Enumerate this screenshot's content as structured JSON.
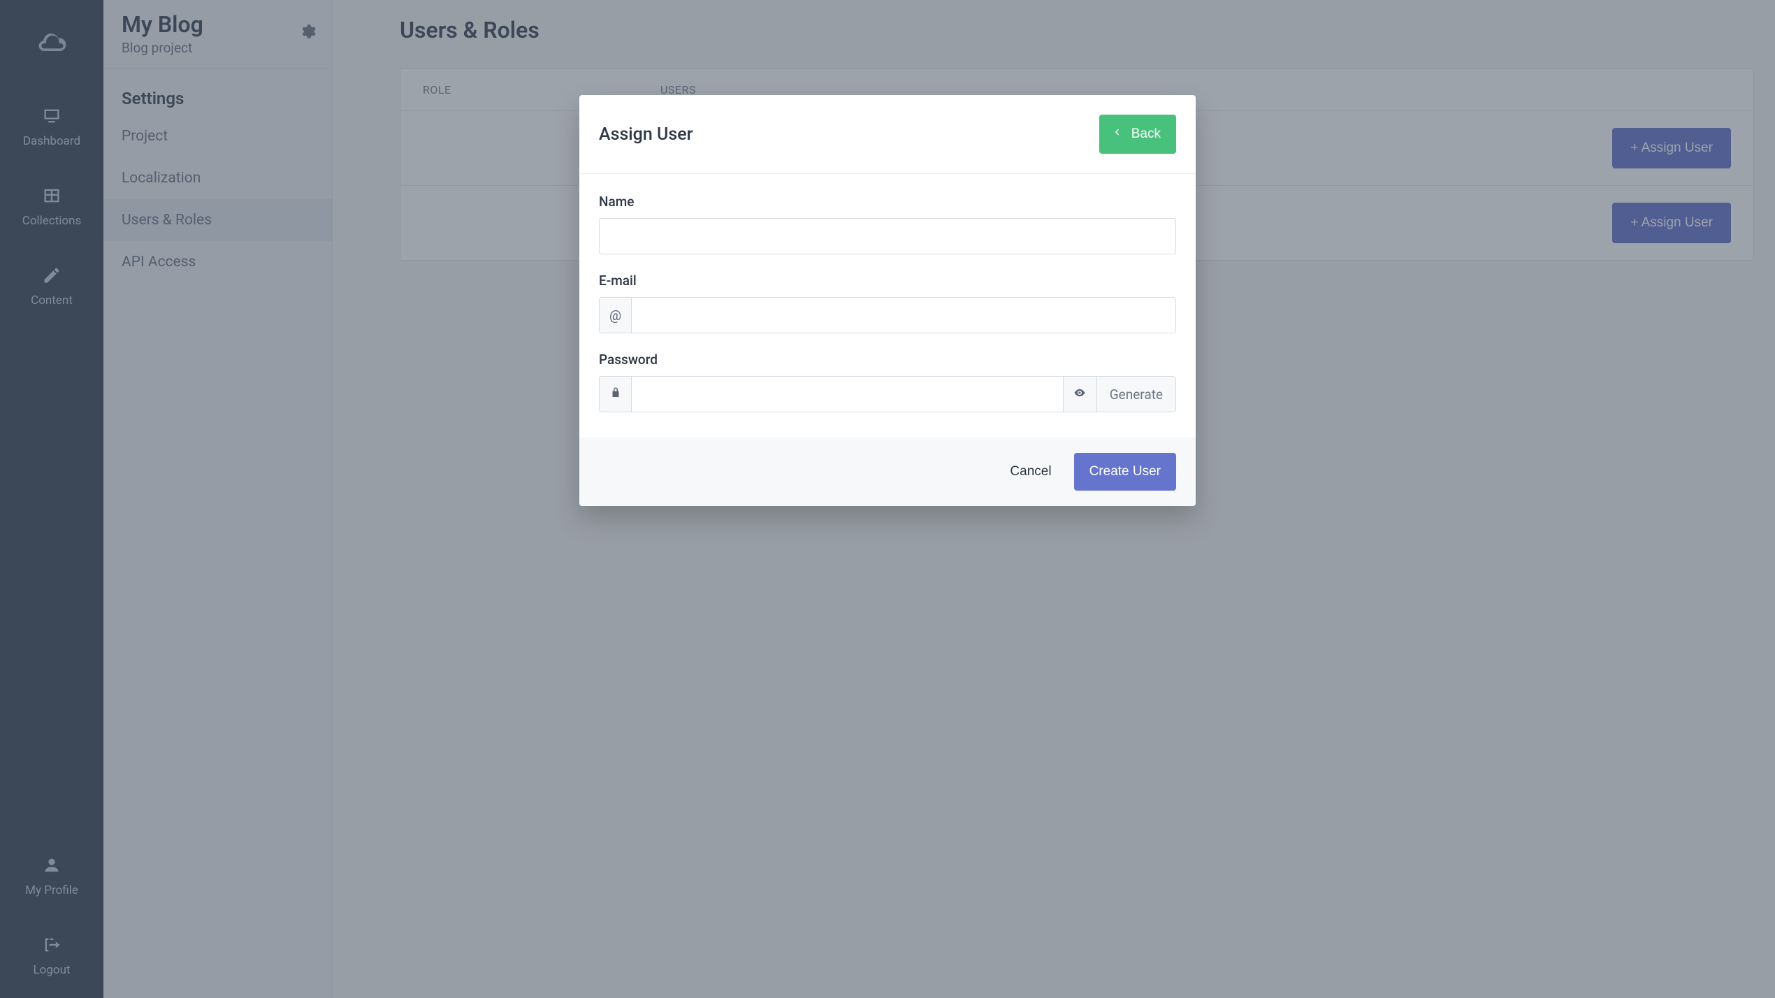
{
  "rail": {
    "items": [
      {
        "label": "Dashboard"
      },
      {
        "label": "Collections"
      },
      {
        "label": "Content"
      }
    ],
    "bottom": [
      {
        "label": "My Profile"
      },
      {
        "label": "Logout"
      }
    ]
  },
  "side": {
    "title": "My Blog",
    "subtitle": "Blog project",
    "section": "Settings",
    "links": [
      {
        "label": "Project"
      },
      {
        "label": "Localization"
      },
      {
        "label": "Users & Roles"
      },
      {
        "label": "API Access"
      }
    ]
  },
  "main": {
    "title": "Users & Roles",
    "columns": {
      "role": "ROLE",
      "users": "USERS"
    },
    "assign_label": "+ Assign User"
  },
  "modal": {
    "title": "Assign User",
    "back": "Back",
    "fields": {
      "name": {
        "label": "Name",
        "value": ""
      },
      "email": {
        "label": "E-mail",
        "prefix": "@",
        "value": ""
      },
      "password": {
        "label": "Password",
        "value": "",
        "generate": "Generate"
      }
    },
    "cancel": "Cancel",
    "submit": "Create User"
  }
}
